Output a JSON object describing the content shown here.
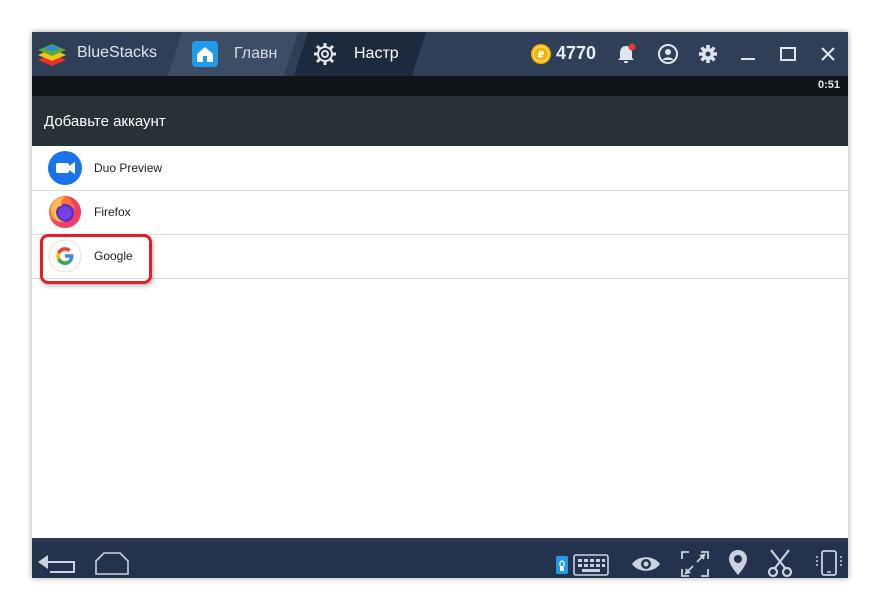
{
  "titlebar": {
    "app_name": "BlueStacks",
    "tabs": [
      {
        "label": "Главн",
        "icon": "home-icon"
      },
      {
        "label": "Настр",
        "icon": "gear-icon"
      }
    ],
    "coins": "4770",
    "coin_icon": "coin-icon",
    "icons": [
      "notification-bell-icon",
      "account-icon",
      "settings-gear-icon",
      "minimize-icon",
      "maximize-icon",
      "close-icon"
    ],
    "accent_colors": {
      "titlebar": "#2f3f57",
      "coin": "#f4b400",
      "notification_dot": "#e53935"
    }
  },
  "status_bar": {
    "time": "0:51"
  },
  "action_bar": {
    "title": "Добавьте аккаунт"
  },
  "accounts": [
    {
      "label": "Duo Preview",
      "icon": "duo-icon"
    },
    {
      "label": "Firefox",
      "icon": "firefox-icon"
    },
    {
      "label": "Google",
      "icon": "google-icon",
      "highlighted": true
    }
  ],
  "navbar": {
    "icons": [
      "back-icon",
      "home-icon",
      "keyboard-icon",
      "eye-icon",
      "fullscreen-icon",
      "location-icon",
      "scissors-icon",
      "phone-rotate-icon"
    ]
  }
}
